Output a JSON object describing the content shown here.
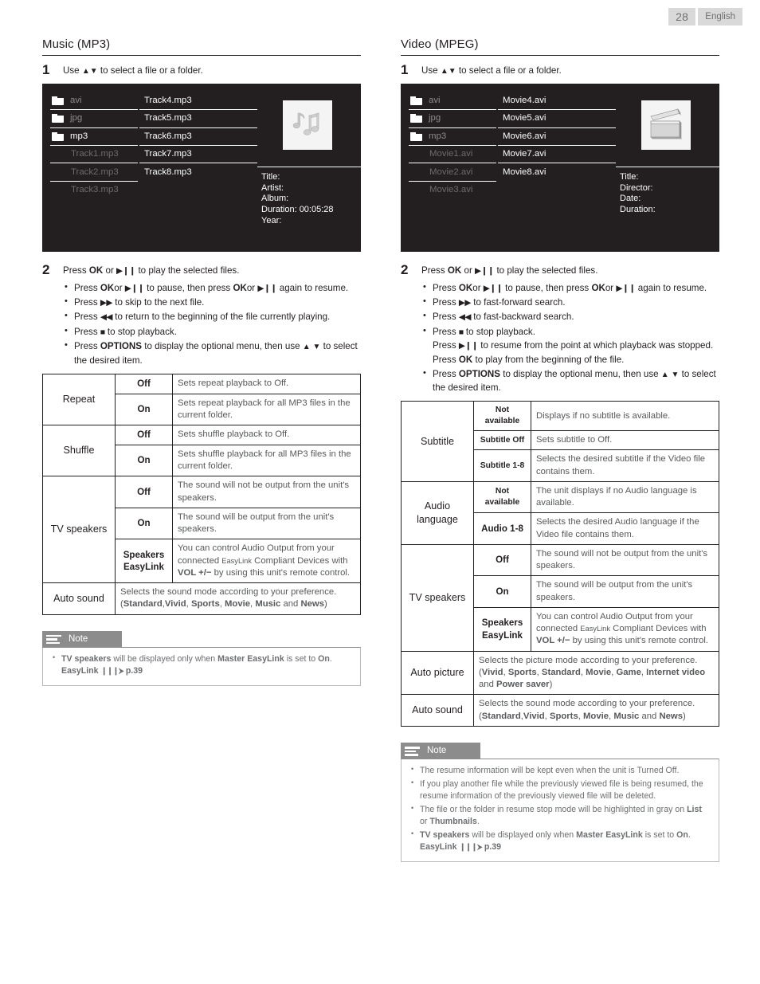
{
  "header": {
    "page_number": "28",
    "language": "English"
  },
  "left": {
    "title": "Music (MP3)",
    "step1": {
      "num": "1",
      "text_before": "Use",
      "glyphs": "▲▼",
      "text_after": "to select a file or a folder."
    },
    "screen": {
      "folders": [
        {
          "label": "avi",
          "state": "dim"
        },
        {
          "label": "jpg",
          "state": "dim"
        },
        {
          "label": "mp3",
          "state": "bright"
        }
      ],
      "files_left": [
        {
          "label": "Track1.mp3",
          "state": "dim"
        },
        {
          "label": "Track2.mp3",
          "state": "dim"
        },
        {
          "label": "Track3.mp3",
          "state": "dim"
        }
      ],
      "files_right": [
        "Track4.mp3",
        "Track5.mp3",
        "Track6.mp3",
        "Track7.mp3",
        "Track8.mp3"
      ],
      "thumbnail_icon": "music-note-icon",
      "info": [
        "Title:",
        "Artist:",
        "Album:",
        "Duration: 00:05:28",
        "Year:"
      ]
    },
    "step2": {
      "num": "2",
      "lead": {
        "pre": "Press",
        "k1": "OK",
        "mid": "or",
        "g1": "▶❙❙",
        "post": "to play the selected files."
      },
      "bullets": [
        "Press <b>OK</b>or <span class=\"glyph\">▶❙❙</span> to pause, then press <b>OK</b>or <span class=\"glyph\">▶❙❙</span> again to resume.",
        "Press <span class=\"glyph\">▶▶</span> to skip to the next file.",
        "Press <span class=\"glyph\">◀◀</span> to return to the beginning of the file currently playing.",
        "Press <span class=\"glyph\">■</span> to stop playback.",
        "Press <b>OPTIONS</b> to display the optional menu, then use <span class=\"tri\">▲ ▼</span> to select the desired item."
      ]
    },
    "table": [
      {
        "name": "Repeat",
        "rows": [
          {
            "value": "Off",
            "desc": "Sets repeat playback to Off."
          },
          {
            "value": "On",
            "desc": "Sets repeat playback for all MP3 files in the current folder."
          }
        ]
      },
      {
        "name": "Shuffle",
        "rows": [
          {
            "value": "Off",
            "desc": "Sets shuffle playback to Off."
          },
          {
            "value": "On",
            "desc": "Sets shuffle playback for all MP3 files in the current folder."
          }
        ]
      },
      {
        "name": "TV speakers",
        "rows": [
          {
            "value": "Off",
            "desc": "The sound will not be output from the unit's speakers."
          },
          {
            "value": "On",
            "desc": "The sound will be output from the unit's speakers."
          },
          {
            "value": "Speakers EasyLink",
            "desc": "You can control Audio Output from your connected <span class=\"tiny\">EasyLink</span> Compliant Devices with <b>VOL +/−</b> by using this unit's remote control."
          }
        ]
      },
      {
        "name": "Auto sound",
        "span_desc": "Selects the sound mode according to your preference. (<b>Standard</b>,<b>Vivid</b>, <b>Sports</b>, <b>Movie</b>, <b>Music</b> and <b>News</b>)"
      }
    ],
    "note": {
      "label": "Note",
      "icon": "note-lines-icon",
      "items": [
        "<b>TV speakers</b> will be displayed only when <b>Master EasyLink</b> is set to <b>On</b>.<br><b>EasyLink</b> <span class=\"arrowref\">❙❙❙⮞</span> <b>p.39</b>"
      ]
    }
  },
  "right": {
    "title": "Video (MPEG)",
    "step1": {
      "num": "1",
      "text_before": "Use",
      "glyphs": "▲▼",
      "text_after": "to select a file or a folder."
    },
    "screen": {
      "folders": [
        {
          "label": "avi",
          "state": "dim"
        },
        {
          "label": "jpg",
          "state": "dim"
        },
        {
          "label": "mp3",
          "state": "dim"
        }
      ],
      "files_left": [
        {
          "label": "Movie1.avi",
          "state": "dim"
        },
        {
          "label": "Movie2.avi",
          "state": "dim"
        },
        {
          "label": "Movie3.avi",
          "state": "dim"
        }
      ],
      "files_right": [
        "Movie4.avi",
        "Movie5.avi",
        "Movie6.avi",
        "Movie7.avi",
        "Movie8.avi"
      ],
      "thumbnail_icon": "film-clapper-icon",
      "info": [
        "Title:",
        "Director:",
        "Date:",
        "Duration:"
      ]
    },
    "step2": {
      "num": "2",
      "lead": {
        "pre": "Press",
        "k1": "OK",
        "mid": "or",
        "g1": "▶❙❙",
        "post": "to play the selected files."
      },
      "bullets": [
        "Press <b>OK</b>or <span class=\"glyph\">▶❙❙</span> to pause, then press <b>OK</b>or <span class=\"glyph\">▶❙❙</span> again to resume.",
        "Press <span class=\"glyph\">▶▶</span> to fast-forward search.",
        "Press <span class=\"glyph\">◀◀</span> to fast-backward search.",
        "Press <span class=\"glyph\">■</span> to stop playback.<br>Press <span class=\"glyph\">▶❙❙</span> to resume from the point at which playback was stopped. Press <b>OK</b> to play from the beginning of the file.",
        "Press <b>OPTIONS</b> to display the optional menu, then use <span class=\"tri\">▲ ▼</span> to select the desired item."
      ]
    },
    "table": [
      {
        "name": "Subtitle",
        "rows": [
          {
            "value": "Not available",
            "small": true,
            "desc": "Displays if no subtitle is available."
          },
          {
            "value": "Subtitle Off",
            "small": true,
            "desc": "Sets subtitle to Off."
          },
          {
            "value": "Subtitle 1-8",
            "small": true,
            "desc": "Selects the desired subtitle if the Video file contains them."
          }
        ]
      },
      {
        "name": "Audio language",
        "rows": [
          {
            "value": "Not available",
            "small": true,
            "desc": "The unit displays if no Audio language is available."
          },
          {
            "value": "Audio 1-8",
            "desc": "Selects the desired Audio language if the Video file contains them."
          }
        ]
      },
      {
        "name": "TV speakers",
        "rows": [
          {
            "value": "Off",
            "desc": "The sound will not be output from the unit's speakers."
          },
          {
            "value": "On",
            "desc": "The sound will be output from the unit's speakers."
          },
          {
            "value": "Speakers EasyLink",
            "desc": "You can control Audio Output from your connected <span class=\"tiny\">EasyLink</span> Compliant Devices with <b>VOL +/−</b> by using this unit's remote control."
          }
        ]
      },
      {
        "name": "Auto picture",
        "span_desc": "Selects the picture mode according to your preference. (<b>Vivid</b>, <b>Sports</b>, <b>Standard</b>, <b>Movie</b>, <b>Game</b>, <b>Internet video</b> and <b>Power saver</b>)"
      },
      {
        "name": "Auto sound",
        "span_desc": "Selects the sound mode according to your preference. (<b>Standard</b>,<b>Vivid</b>, <b>Sports</b>, <b>Movie</b>, <b>Music</b> and <b>News</b>)"
      }
    ],
    "note": {
      "label": "Note",
      "icon": "note-lines-icon",
      "items": [
        "The resume information will be kept even when the unit is Turned Off.",
        "If you play another file while the previously viewed file is being resumed, the resume information of the previously viewed file will be deleted.",
        "The file or the folder in resume stop mode will be highlighted in gray on <b>List</b> or <b>Thumbnails</b>.",
        "<b>TV speakers</b> will be displayed only when <b>Master EasyLink</b> is set to <b>On</b>.<br><b>EasyLink</b> <span class=\"arrowref\">❙❙❙⮞</span> <b>p.39</b>"
      ]
    }
  },
  "colors": {
    "ink": "#231f20",
    "screen_bg": "#231f20",
    "note_head": "#8c8c8c",
    "header_chip": "#d9d9d9"
  }
}
